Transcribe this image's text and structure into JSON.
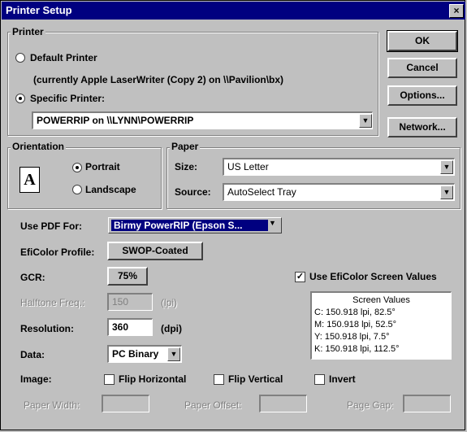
{
  "window": {
    "title": "Printer Setup",
    "close_glyph": "×"
  },
  "printer": {
    "legend": "Printer",
    "default_label": "Default Printer",
    "default_desc": "(currently Apple LaserWriter (Copy 2) on \\\\Pavilion\\bx)",
    "specific_label": "Specific Printer:",
    "selected": "POWERRIP on \\\\LYNN\\POWERRIP"
  },
  "buttons": {
    "ok": "OK",
    "cancel": "Cancel",
    "options": "Options...",
    "network": "Network..."
  },
  "orientation": {
    "legend": "Orientation",
    "portrait": "Portrait",
    "landscape": "Landscape",
    "icon_letter": "A"
  },
  "paper": {
    "legend": "Paper",
    "size_label": "Size:",
    "size_value": "US Letter",
    "source_label": "Source:",
    "source_value": "AutoSelect Tray"
  },
  "pdf": {
    "label": "Use PDF For:",
    "value": "Birmy PowerRIP (Epson S..."
  },
  "eficolor": {
    "label": "EfiColor Profile:",
    "value": "SWOP-Coated",
    "screen_values_label": "Use EfiColor Screen Values"
  },
  "gcr": {
    "label": "GCR:",
    "value": "75%"
  },
  "halftone": {
    "label": "Halftone Freq.:",
    "value": "150",
    "unit": "(lpi)"
  },
  "resolution": {
    "label": "Resolution:",
    "value": "360",
    "unit": "(dpi)"
  },
  "data": {
    "label": "Data:",
    "value": "PC Binary"
  },
  "image": {
    "label": "Image:",
    "flip_h": "Flip Horizontal",
    "flip_v": "Flip Vertical",
    "invert": "Invert"
  },
  "bottom": {
    "paper_width": "Paper Width:",
    "paper_offset": "Paper Offset:",
    "page_gap": "Page Gap:"
  },
  "screen_values": {
    "title": "Screen Values",
    "rows": [
      "C: 150.918 lpi, 82.5°",
      "M: 150.918 lpi, 52.5°",
      "Y: 150.918 lpi, 7.5°",
      "K: 150.918 lpi, 112.5°"
    ]
  },
  "check_glyph": "✓",
  "dropdown_glyph": "▼"
}
